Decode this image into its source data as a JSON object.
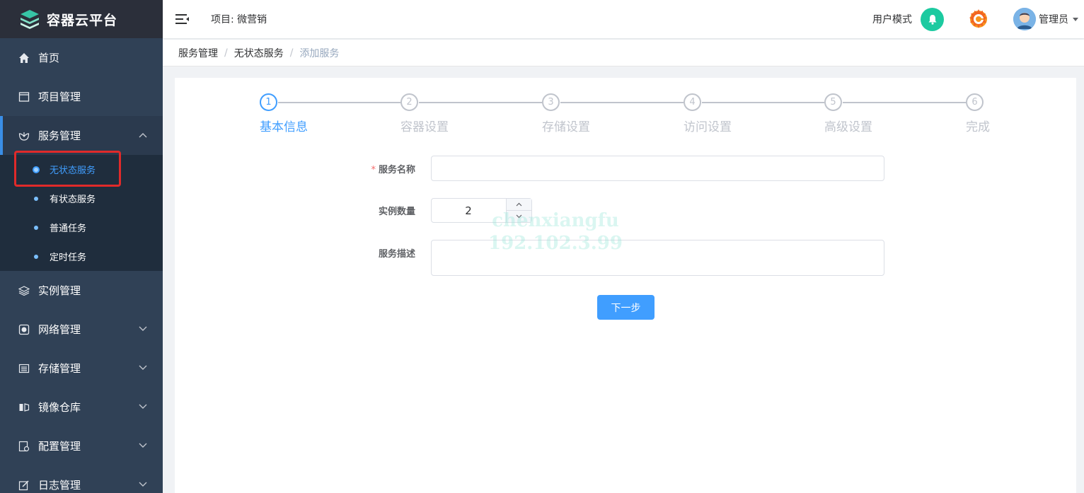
{
  "app": {
    "title": "容器云平台"
  },
  "header": {
    "project_label": "项目: 微营销",
    "mode_label": "用户模式",
    "user_name": "管理员"
  },
  "sidebar": {
    "items": [
      {
        "label": "首页",
        "icon": "home-icon",
        "has_children": false
      },
      {
        "label": "项目管理",
        "icon": "window-icon",
        "has_children": false
      },
      {
        "label": "服务管理",
        "icon": "service-icon",
        "has_children": true,
        "open": true
      },
      {
        "label": "实例管理",
        "icon": "layers-icon",
        "has_children": false
      },
      {
        "label": "网络管理",
        "icon": "globe-icon",
        "has_children": true
      },
      {
        "label": "存储管理",
        "icon": "storage-icon",
        "has_children": true
      },
      {
        "label": "镜像仓库",
        "icon": "image-repo-icon",
        "has_children": true
      },
      {
        "label": "配置管理",
        "icon": "config-icon",
        "has_children": true
      },
      {
        "label": "日志管理",
        "icon": "log-icon",
        "has_children": true
      }
    ],
    "service_sub": [
      {
        "label": "无状态服务",
        "active": true
      },
      {
        "label": "有状态服务"
      },
      {
        "label": "普通任务"
      },
      {
        "label": "定时任务"
      }
    ]
  },
  "breadcrumb": [
    "服务管理",
    "无状态服务",
    "添加服务"
  ],
  "steps": [
    {
      "num": "1",
      "title": "基本信息",
      "active": true
    },
    {
      "num": "2",
      "title": "容器设置"
    },
    {
      "num": "3",
      "title": "存储设置"
    },
    {
      "num": "4",
      "title": "访问设置"
    },
    {
      "num": "5",
      "title": "高级设置"
    },
    {
      "num": "6",
      "title": "完成"
    }
  ],
  "form": {
    "required_mark": "*",
    "name_label": "服务名称",
    "name_value": "",
    "count_label": "实例数量",
    "count_value": "2",
    "desc_label": "服务描述",
    "desc_value": ""
  },
  "actions": {
    "next_label": "下一步"
  },
  "watermark": {
    "line1": "chenxiangfu",
    "line2": "192.102.3.99"
  },
  "colors": {
    "primary": "#409eff",
    "sidebar": "#304156",
    "bell": "#1ccaa0",
    "highlight": "#e02a2a"
  }
}
